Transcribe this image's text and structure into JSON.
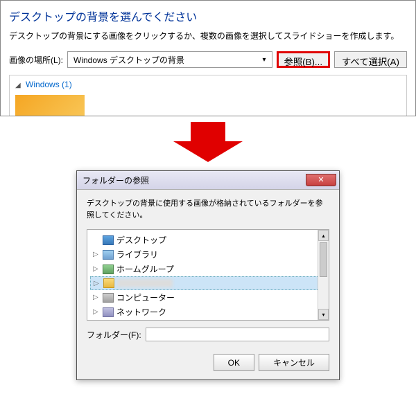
{
  "upper": {
    "title": "デスクトップの背景を選んでください",
    "description": "デスクトップの背景にする画像をクリックするか、複数の画像を選択してスライドショーを作成します。",
    "location_label": "画像の場所(L):",
    "combo_value": "Windows デスクトップの背景",
    "browse_btn": "参照(B)...",
    "select_all_btn": "すべて選択(A)",
    "gallery_group": "Windows (1)"
  },
  "dialog": {
    "title": "フォルダーの参照",
    "message": "デスクトップの背景に使用する画像が格納されているフォルダーを参照してください。",
    "tree": [
      {
        "icon": "desktop",
        "label": "デスクトップ",
        "expand": ""
      },
      {
        "icon": "lib",
        "label": "ライブラリ",
        "expand": "▷"
      },
      {
        "icon": "home",
        "label": "ホームグループ",
        "expand": "▷"
      },
      {
        "icon": "folder",
        "label": "",
        "expand": "▷",
        "blurred": true
      },
      {
        "icon": "pc",
        "label": "コンピューター",
        "expand": "▷"
      },
      {
        "icon": "net",
        "label": "ネットワーク",
        "expand": "▷"
      }
    ],
    "folder_label": "フォルダー(F):",
    "folder_value": "",
    "ok": "OK",
    "cancel": "キャンセル"
  }
}
